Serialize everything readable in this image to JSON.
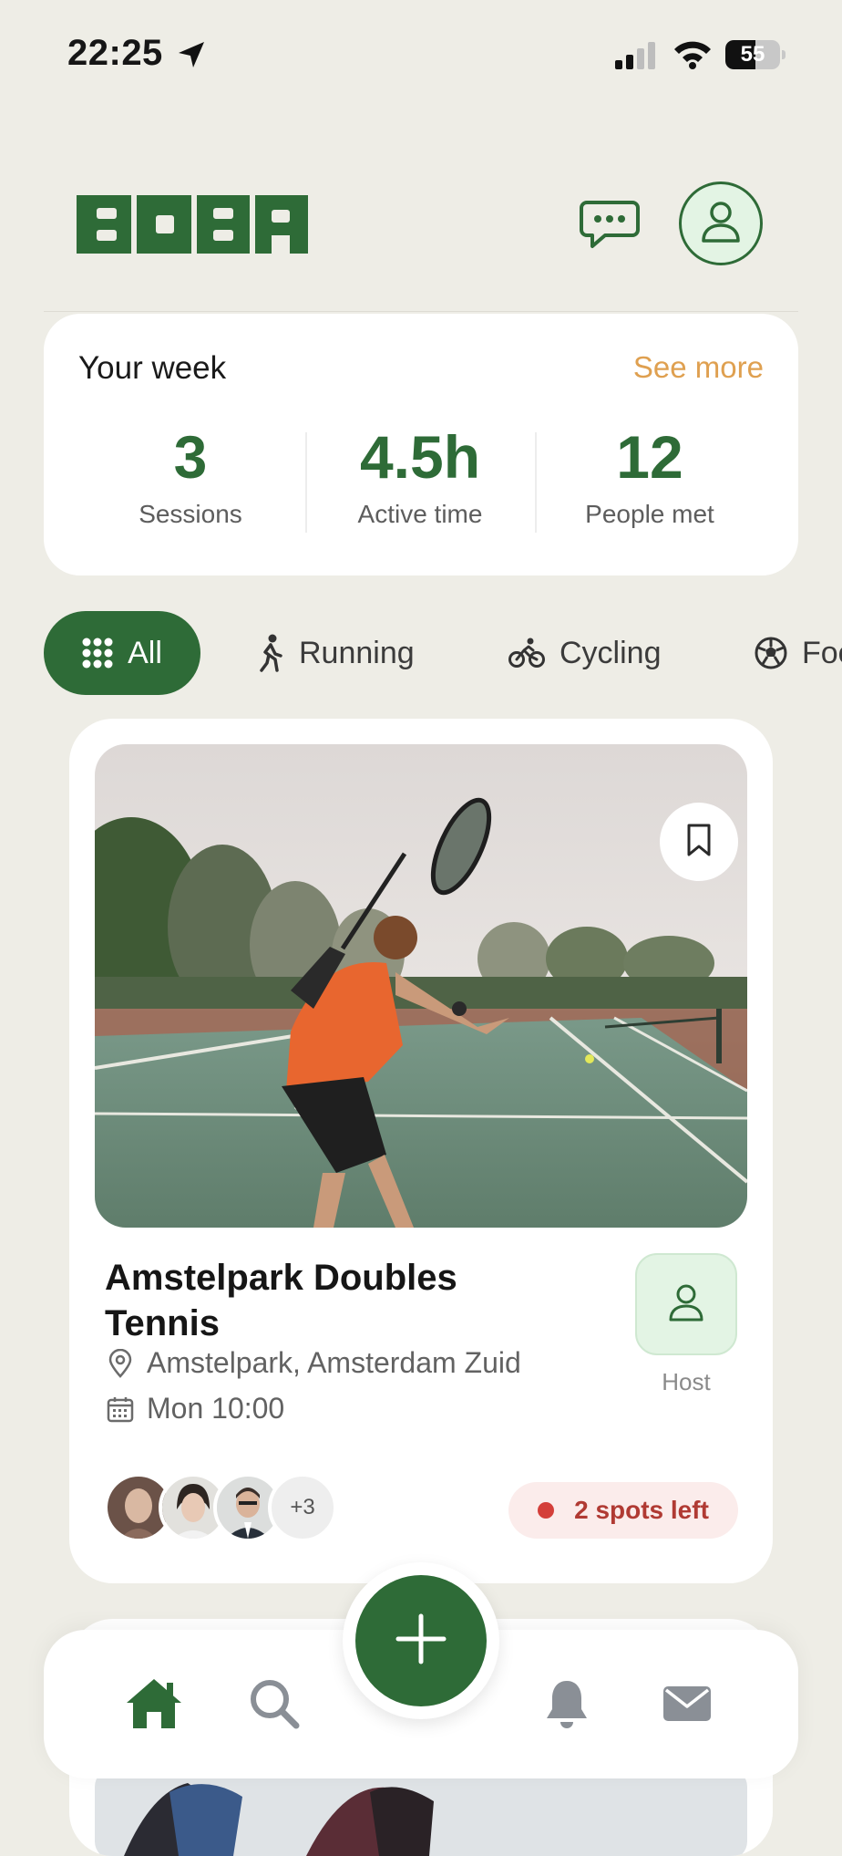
{
  "status_bar": {
    "time": "22:25",
    "battery": "55",
    "battery_level": 0.55
  },
  "header": {
    "logo_text": "BOBA"
  },
  "week_summary": {
    "title": "Your week",
    "see_more": "See more",
    "stats": [
      {
        "value": "3",
        "label": "Sessions"
      },
      {
        "value": "4.5h",
        "label": "Active time"
      },
      {
        "value": "12",
        "label": "People met"
      }
    ]
  },
  "filters": [
    {
      "label": "All",
      "icon": "grid-icon",
      "active": true
    },
    {
      "label": "Running",
      "icon": "running-icon",
      "active": false
    },
    {
      "label": "Cycling",
      "icon": "cycling-icon",
      "active": false
    },
    {
      "label": "Football",
      "icon": "football-icon",
      "active": false
    }
  ],
  "activity": {
    "title": "Amstelpark Doubles Tennis",
    "location": "Amstelpark, Amsterdam Zuid",
    "time": "Mon 10:00",
    "host_label": "Host",
    "participants_more": "+3",
    "spots_left": "2 spots left"
  },
  "nav": {
    "items": [
      "home-icon",
      "search-icon",
      "add-icon",
      "bell-icon",
      "mail-icon"
    ],
    "active": "home"
  },
  "colors": {
    "primary": "#2e6b37",
    "accent": "#dfa050",
    "background": "#eeede6",
    "alert": "#d43f3a"
  }
}
